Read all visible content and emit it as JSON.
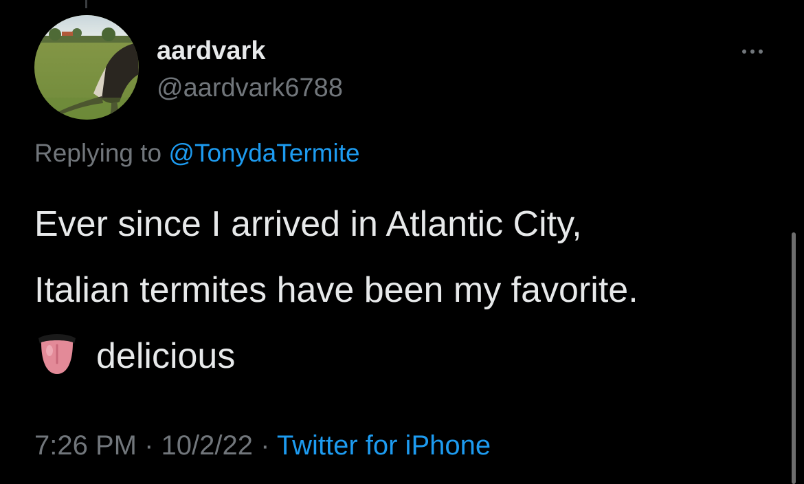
{
  "tweet": {
    "author": {
      "display_name": "aardvark",
      "handle": "@aardvark6788",
      "avatar_icon": "anteater-photo"
    },
    "reply": {
      "prefix": "Replying to",
      "mention": "@TonydaTermite"
    },
    "text_lines": [
      "Ever since I arrived in Atlantic City,",
      "Italian termites have been my favorite."
    ],
    "emoji_icon": "tongue-emoji",
    "emoji_text": "delicious",
    "meta": {
      "time": "7:26 PM",
      "separator": "·",
      "date": "10/2/22",
      "source": "Twitter for iPhone"
    },
    "more_icon": "more-options-icon"
  },
  "colors": {
    "background": "#000000",
    "primary_text": "#e7e9ea",
    "secondary_text": "#71767b",
    "link": "#1d9bf0"
  }
}
